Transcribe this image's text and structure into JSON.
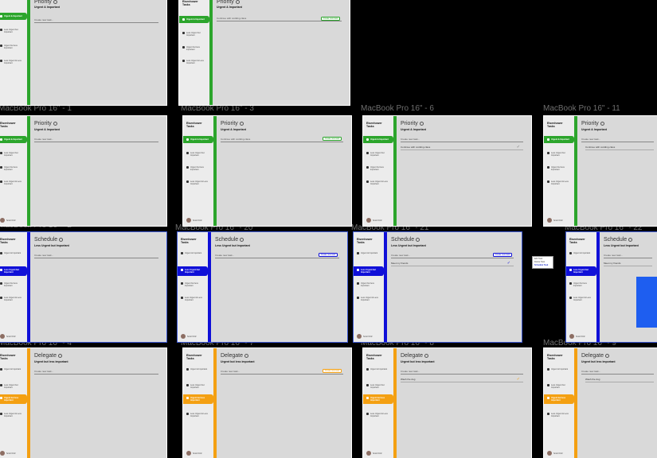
{
  "colors": {
    "priority": "#2ca52c",
    "schedule": "#1010d8",
    "delegate": "#f4a012",
    "selection": "#3f5bd6"
  },
  "app_title": "Eisenhower Tasks",
  "user_name": "Scott Ortiz",
  "nav_priority": "Urgent & Important",
  "nav_schedule": "Less Urgent but Important",
  "nav_delegate": "Urgent but less important",
  "nav_eliminate": "Less Urgent & Less Important",
  "pages": {
    "priority": {
      "title": "Priority",
      "subtitle": "Urgent & Important"
    },
    "schedule": {
      "title": "Schedule",
      "subtitle": "Less Urgent but Important"
    },
    "delegate": {
      "title": "Delegate",
      "subtitle": "Urgent but less important"
    }
  },
  "texts": {
    "add_task_placeholder": "Create new task...",
    "priority_input_typed": "Continue with codding class",
    "priority_task": "Continue with codding class",
    "schedule_input": "Create new task...",
    "schedule_task": "Meet my friends",
    "delegate_input": "Create new task...",
    "delegate_task": "Wash the dog",
    "create_button": "Create new task"
  },
  "frames": [
    {
      "label": "MacBook Pro 16\" - 1"
    },
    {
      "label": "MacBook Pro 16\" - 3"
    },
    {
      "label": "MacBook Pro 16\" - 6"
    },
    {
      "label": "MacBook Pro 16\" - 11"
    },
    {
      "label": "MacBook Pro 16\" - 2"
    },
    {
      "label": "MacBook Pro 16\" - 20"
    },
    {
      "label": "MacBook Pro 16\" - 21"
    },
    {
      "label": "MacBook Pro 16\" - 22"
    },
    {
      "label": "MacBook Pro 16\" - 4"
    },
    {
      "label": "MacBook Pro 16\" - 7"
    },
    {
      "label": "MacBook Pro 16\" - 8"
    },
    {
      "label": "MacBook Pro 16\" - 9"
    }
  ],
  "popup": {
    "items": [
      "Edit Task",
      "Delete Task",
      "Schedule Task"
    ]
  }
}
